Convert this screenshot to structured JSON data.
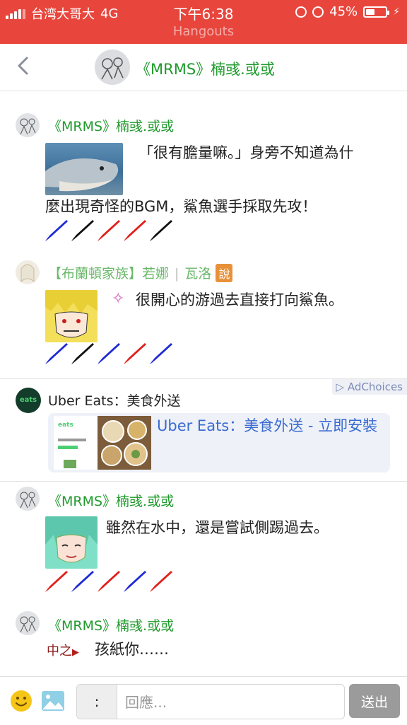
{
  "status_bar": {
    "carrier": "台湾大哥大",
    "network": "4G",
    "time": "下午6:38",
    "battery": "45%",
    "battery_level": 0.45,
    "subtitle": "Hangouts"
  },
  "header": {
    "back_icon": "chevron-left-icon",
    "title": "《MRMS》楠彧.或或"
  },
  "posts": [
    {
      "username": "《MRMS》楠彧.或或",
      "text_line1": "「很有膽量嘛。」身旁不知道為什",
      "text_line2": "麼出現奇怪的BGM，鯊魚選手採取先攻！",
      "horn_colors": [
        "#1f2bd6",
        "#111111",
        "#e0201a",
        "#e0201a",
        "#111111"
      ]
    },
    {
      "username": "【布蘭頓家族】若娜",
      "role": "瓦洛",
      "badge": "說",
      "text": "很開心的游過去直接打向鯊魚。",
      "horn_colors": [
        "#1f2bd6",
        "#111111",
        "#1f2bd6",
        "#e0201a",
        "#1f2bd6"
      ]
    },
    {
      "username": "《MRMS》楠彧.或或",
      "text": "雖然在水中，還是嘗試側踢過去。",
      "horn_colors": [
        "#e0201a",
        "#1f2bd6",
        "#e0201a",
        "#1f2bd6",
        "#e0201a"
      ]
    },
    {
      "username": "《MRMS》楠彧.或或",
      "tag": "中之",
      "text": "孩紙你……"
    }
  ],
  "ad": {
    "adchoices": "AdChoices",
    "brand_logo": "eats",
    "title": "Uber Eats：美食外送",
    "card_link": "Uber Eats：美食外送 - 立即安裝"
  },
  "composer": {
    "colon": ":",
    "placeholder": "回應...",
    "send": "送出"
  },
  "colors": {
    "status_bar": "#e8463d",
    "username_green": "#1f9a2c",
    "ad_link_blue": "#3a6bd1",
    "badge_orange": "#e7913a"
  }
}
